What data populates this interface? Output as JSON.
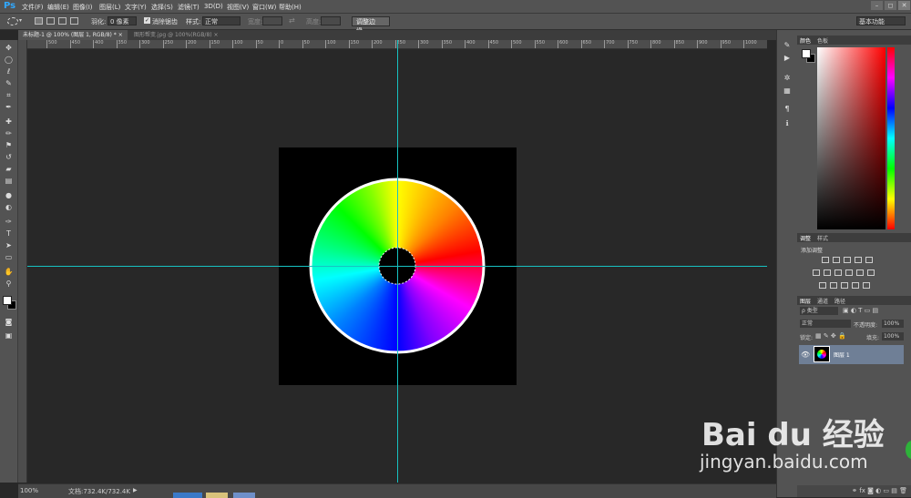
{
  "app": {
    "logo": "Ps"
  },
  "menu": [
    "文件(F)",
    "编辑(E)",
    "图像(I)",
    "图层(L)",
    "文字(Y)",
    "选择(S)",
    "滤镜(T)",
    "3D(D)",
    "视图(V)",
    "窗口(W)",
    "帮助(H)"
  ],
  "window_controls": [
    "–",
    "◻",
    "✕"
  ],
  "options": {
    "feather_label": "羽化:",
    "feather_value": "0 像素",
    "antialias_label": "消除锯齿",
    "style_label": "样式:",
    "style_value": "正常",
    "width_label": "宽度:",
    "height_label": "高度:",
    "refine_edge_button": "调整边缘...",
    "workspace_value": "基本功能"
  },
  "tabs": [
    {
      "label": "未标题-1 @ 100% (图层 1, RGB/8) *",
      "close": "×",
      "active": true
    },
    {
      "label": "图形帮变.jpg @ 100%(RGB/8)",
      "close": "×",
      "active": false
    }
  ],
  "ruler_labels": [
    "500",
    "450",
    "400",
    "350",
    "300",
    "250",
    "200",
    "150",
    "100",
    "50",
    "0",
    "50",
    "100",
    "150",
    "200",
    "250",
    "300",
    "350",
    "400",
    "450",
    "500",
    "550",
    "600",
    "650",
    "700",
    "750",
    "800",
    "850",
    "900",
    "950",
    "1000"
  ],
  "status": {
    "zoom": "100%",
    "doc_info": "文档:732.4K/732.4K"
  },
  "color_panel": {
    "tabs": [
      "颜色",
      "色板"
    ]
  },
  "adjustments_panel": {
    "tabs": [
      "调整",
      "样式"
    ],
    "title": "添加调整"
  },
  "layers_panel": {
    "tabs": [
      "图层",
      "通道",
      "路径"
    ],
    "kind_filter": "ρ 类型",
    "blend_mode": "正常",
    "opacity_label": "不透明度:",
    "opacity_value": "100%",
    "lock_label": "锁定:",
    "fill_label": "填充:",
    "fill_value": "100%",
    "layers": [
      {
        "name": "图层 1",
        "visible": true
      }
    ]
  },
  "watermark": {
    "brand": "Bai du 经验",
    "url": "jingyan.baidu.com"
  },
  "colors": {
    "guide": "#17c2c2",
    "selected_layer": "#6f7f96",
    "app_bg": "#282828"
  },
  "icons": {
    "tools": [
      "move-icon",
      "ellipse-marquee-icon",
      "lasso-icon",
      "quick-select-icon",
      "crop-icon",
      "eyedropper-icon",
      "healing-brush-icon",
      "brush-icon",
      "clone-stamp-icon",
      "history-brush-icon",
      "eraser-icon",
      "gradient-icon",
      "blur-icon",
      "dodge-icon",
      "pen-icon",
      "type-icon",
      "path-select-icon",
      "rectangle-shape-icon",
      "hand-icon",
      "zoom-icon"
    ]
  }
}
